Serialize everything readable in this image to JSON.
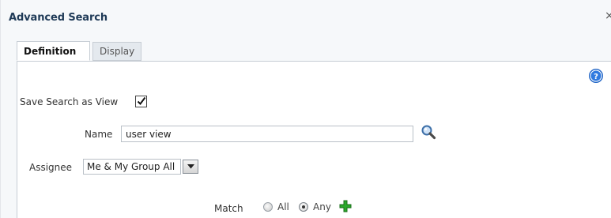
{
  "dialog": {
    "title": "Advanced Search",
    "close_glyph": "×"
  },
  "tabs": [
    {
      "label": "Definition",
      "active": true
    },
    {
      "label": "Display",
      "active": false
    }
  ],
  "help": {
    "icon": "help-icon",
    "glyph": "?"
  },
  "form": {
    "save_as_view": {
      "label": "Save Search as View",
      "checked": true
    },
    "name": {
      "label": "Name",
      "value": "user view"
    },
    "assignee": {
      "label": "Assignee",
      "selected": "Me & My Group All"
    },
    "match": {
      "label": "Match",
      "options": [
        {
          "label": "All",
          "selected": false
        },
        {
          "label": "Any",
          "selected": true
        }
      ]
    }
  },
  "icons": {
    "search": "search-icon",
    "add": "add-icon",
    "dropdown": "chevron-down-icon",
    "check": "checkmark-icon"
  },
  "colors": {
    "title": "#1f3a57",
    "help_blue": "#1e63c5",
    "add_green": "#2aa82a"
  }
}
